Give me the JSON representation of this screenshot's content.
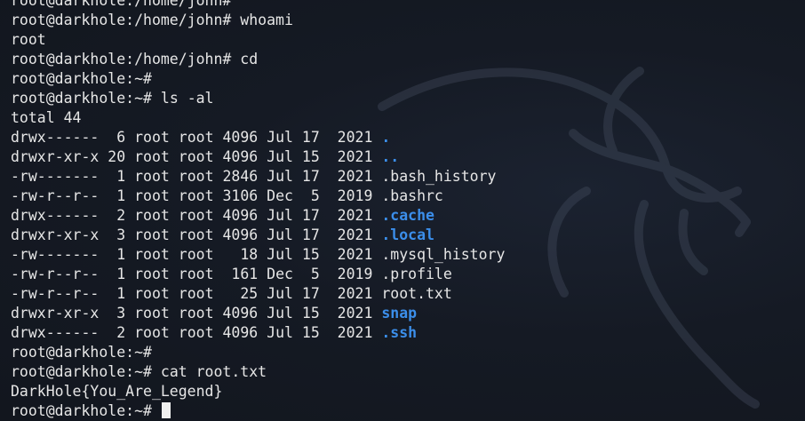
{
  "terminal": {
    "lines": [
      {
        "kind": "prompt",
        "prompt": "root@darkhole:/home/john#",
        "command": ""
      },
      {
        "kind": "prompt",
        "prompt": "root@darkhole:/home/john#",
        "command": " whoami"
      },
      {
        "kind": "output",
        "text": "root"
      },
      {
        "kind": "prompt",
        "prompt": "root@darkhole:/home/john#",
        "command": " cd"
      },
      {
        "kind": "prompt",
        "prompt": "root@darkhole:~#",
        "command": ""
      },
      {
        "kind": "prompt",
        "prompt": "root@darkhole:~#",
        "command": " ls -al"
      },
      {
        "kind": "output",
        "text": "total 44"
      },
      {
        "kind": "entry",
        "perms": "drwx------",
        "links": " 6",
        "owner": "root",
        "group": "root",
        "size": "4096",
        "month": "Jul",
        "day": "17",
        "year": " 2021",
        "name": ".",
        "is_dir": true
      },
      {
        "kind": "entry",
        "perms": "drwxr-xr-x",
        "links": "20",
        "owner": "root",
        "group": "root",
        "size": "4096",
        "month": "Jul",
        "day": "15",
        "year": " 2021",
        "name": "..",
        "is_dir": true
      },
      {
        "kind": "entry",
        "perms": "-rw-------",
        "links": " 1",
        "owner": "root",
        "group": "root",
        "size": "2846",
        "month": "Jul",
        "day": "17",
        "year": " 2021",
        "name": ".bash_history",
        "is_dir": false
      },
      {
        "kind": "entry",
        "perms": "-rw-r--r--",
        "links": " 1",
        "owner": "root",
        "group": "root",
        "size": "3106",
        "month": "Dec",
        "day": " 5",
        "year": " 2019",
        "name": ".bashrc",
        "is_dir": false
      },
      {
        "kind": "entry",
        "perms": "drwx------",
        "links": " 2",
        "owner": "root",
        "group": "root",
        "size": "4096",
        "month": "Jul",
        "day": "17",
        "year": " 2021",
        "name": ".cache",
        "is_dir": true
      },
      {
        "kind": "entry",
        "perms": "drwxr-xr-x",
        "links": " 3",
        "owner": "root",
        "group": "root",
        "size": "4096",
        "month": "Jul",
        "day": "17",
        "year": " 2021",
        "name": ".local",
        "is_dir": true
      },
      {
        "kind": "entry",
        "perms": "-rw-------",
        "links": " 1",
        "owner": "root",
        "group": "root",
        "size": "  18",
        "month": "Jul",
        "day": "15",
        "year": " 2021",
        "name": ".mysql_history",
        "is_dir": false
      },
      {
        "kind": "entry",
        "perms": "-rw-r--r--",
        "links": " 1",
        "owner": "root",
        "group": "root",
        "size": " 161",
        "month": "Dec",
        "day": " 5",
        "year": " 2019",
        "name": ".profile",
        "is_dir": false
      },
      {
        "kind": "entry",
        "perms": "-rw-r--r--",
        "links": " 1",
        "owner": "root",
        "group": "root",
        "size": "  25",
        "month": "Jul",
        "day": "17",
        "year": " 2021",
        "name": "root.txt",
        "is_dir": false
      },
      {
        "kind": "entry",
        "perms": "drwxr-xr-x",
        "links": " 3",
        "owner": "root",
        "group": "root",
        "size": "4096",
        "month": "Jul",
        "day": "15",
        "year": " 2021",
        "name": "snap",
        "is_dir": true
      },
      {
        "kind": "entry",
        "perms": "drwx------",
        "links": " 2",
        "owner": "root",
        "group": "root",
        "size": "4096",
        "month": "Jul",
        "day": "15",
        "year": " 2021",
        "name": ".ssh",
        "is_dir": true
      },
      {
        "kind": "prompt",
        "prompt": "root@darkhole:~#",
        "command": ""
      },
      {
        "kind": "prompt",
        "prompt": "root@darkhole:~#",
        "command": " cat root.txt"
      },
      {
        "kind": "output",
        "text": "DarkHole{You_Are_Legend}"
      },
      {
        "kind": "prompt",
        "prompt": "root@darkhole:~#",
        "command": " ",
        "cursor": true
      }
    ]
  },
  "colors": {
    "background": "#14171f",
    "text": "#e6e6e6",
    "directory": "#3b8eea",
    "cursor": "#f0f0f0"
  },
  "icons": {
    "watermark": "kali-dragon-icon"
  }
}
